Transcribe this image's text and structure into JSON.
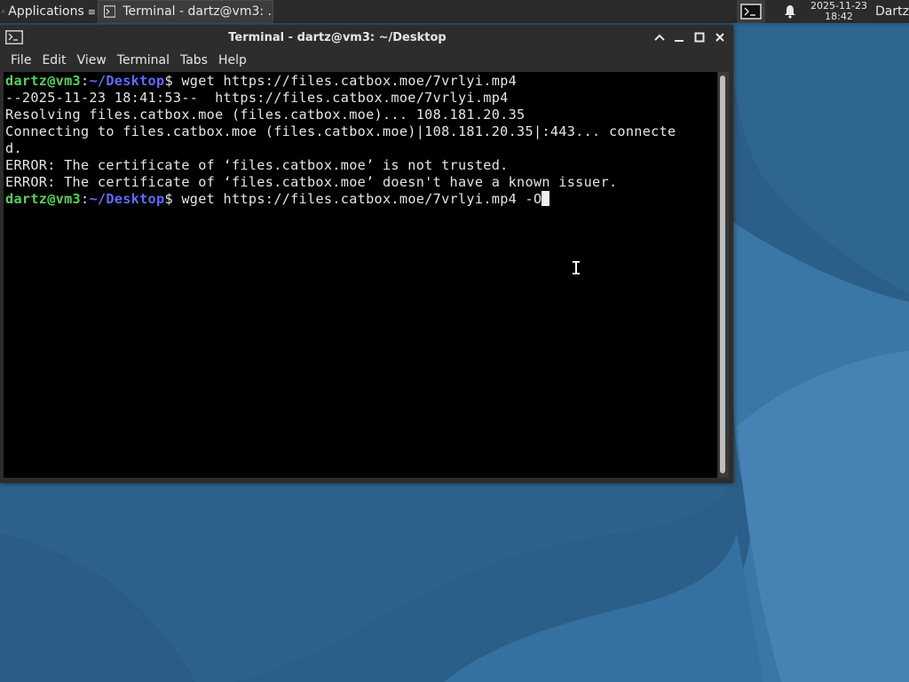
{
  "panel": {
    "apps_label": "Applications",
    "task_label": "Terminal - dartz@vm3: ...",
    "clock_date": "2025-11-23",
    "clock_time": "18:42",
    "user": "Dartz"
  },
  "window": {
    "title": "Terminal - dartz@vm3: ~/Desktop",
    "menus": [
      "File",
      "Edit",
      "View",
      "Terminal",
      "Tabs",
      "Help"
    ]
  },
  "terminal": {
    "prompt_user": "dartz@vm3",
    "prompt_colon": ":",
    "prompt_path": "~/Desktop",
    "prompt_symbol": "$ ",
    "command1": "wget https://files.catbox.moe/7vrlyi.mp4",
    "output": [
      "--2025-11-23 18:41:53--  https://files.catbox.moe/7vrlyi.mp4",
      "Resolving files.catbox.moe (files.catbox.moe)... 108.181.20.35",
      "Connecting to files.catbox.moe (files.catbox.moe)|108.181.20.35|:443... connecte",
      "d.",
      "ERROR: The certificate of ‘files.catbox.moe’ is not trusted.",
      "ERROR: The certificate of ‘files.catbox.moe’ doesn't have a known issuer."
    ],
    "command2": "wget https://files.catbox.moe/7vrlyi.mp4 -O"
  },
  "colors": {
    "prompt_user": "#58d05a",
    "prompt_path": "#5e6bff",
    "terminal_bg": "#000000",
    "desktop_bg": "#2a5d87"
  }
}
